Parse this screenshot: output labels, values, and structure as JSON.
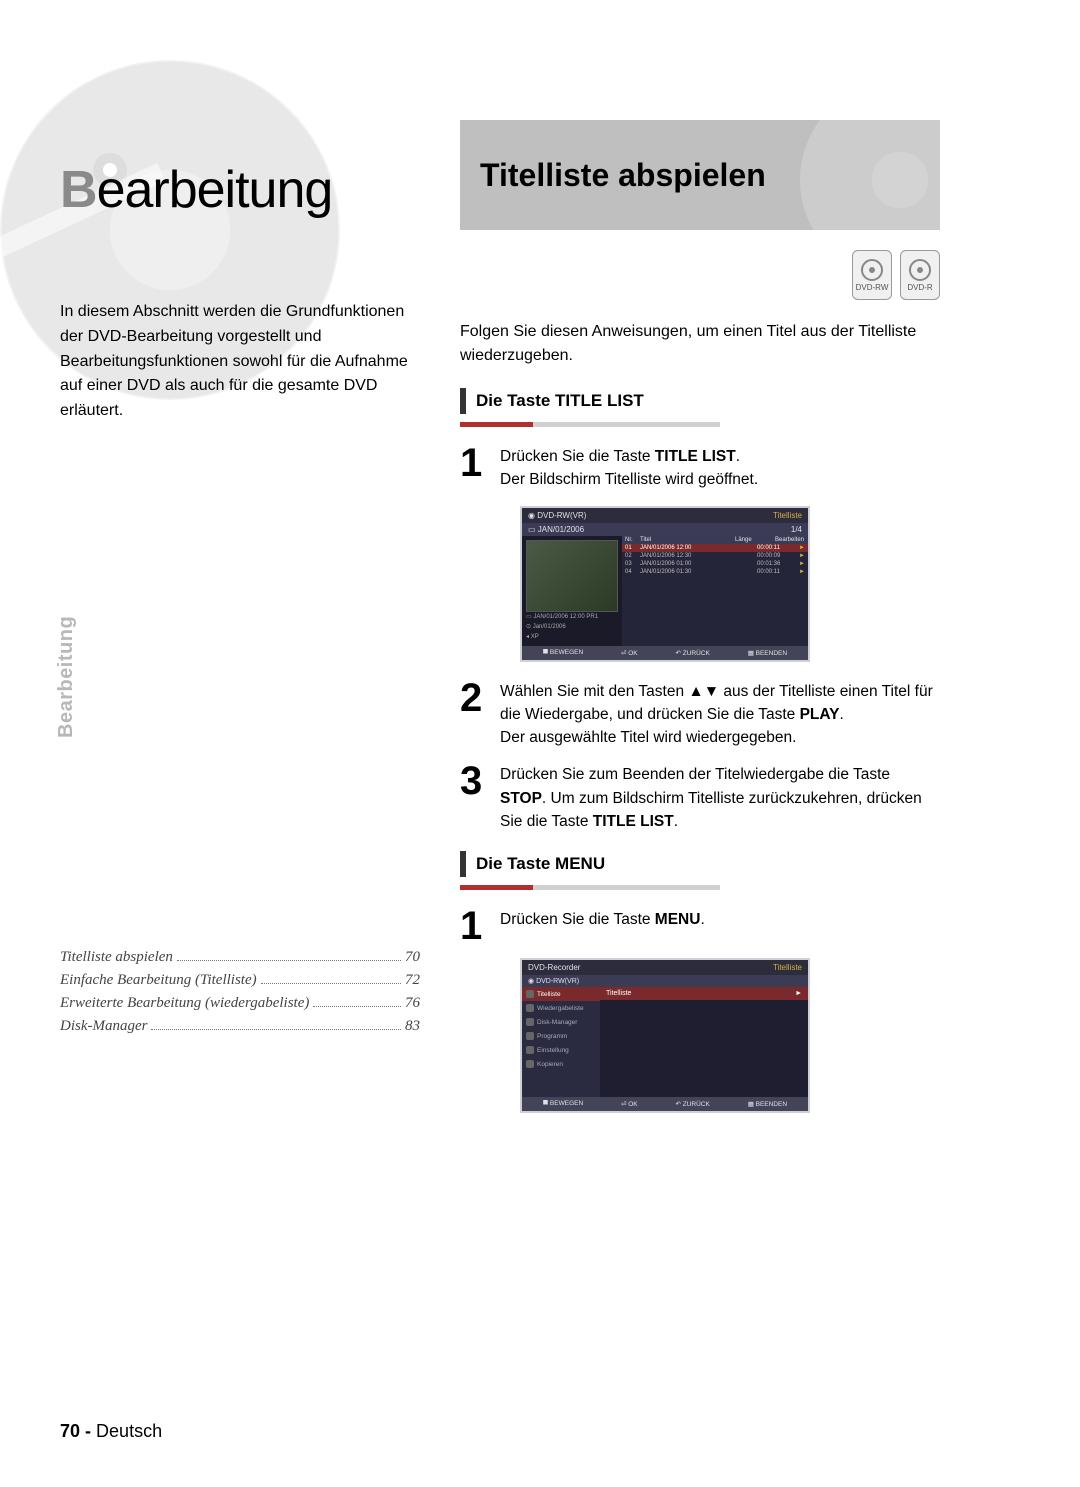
{
  "chapter": {
    "title_first": "B",
    "title_rest": "earbeitung",
    "intro": "In diesem Abschnitt werden die Grundfunktionen der DVD-Bearbeitung vorgestellt und Bearbeitungsfunktionen sowohl für die Aufnahme auf einer DVD als auch für die gesamte DVD erläutert."
  },
  "side_tab": "Bearbeitung",
  "toc": [
    {
      "title": "Titelliste abspielen",
      "page": "70"
    },
    {
      "title": "Einfache Bearbeitung (Titelliste)",
      "page": "72"
    },
    {
      "title": "Erweiterte Bearbeitung (wiedergabeliste)",
      "page": "76"
    },
    {
      "title": "Disk-Manager",
      "page": "83"
    }
  ],
  "footer": {
    "page": "70 -",
    "lang": "Deutsch"
  },
  "section": {
    "banner": "Titelliste abspielen",
    "badges": [
      "DVD-RW",
      "DVD-R"
    ],
    "lead": "Folgen Sie diesen Anweisungen, um einen Titel aus der Titelliste wiederzugeben.",
    "subA": "Die Taste TITLE LIST",
    "subB": "Die Taste MENU",
    "step1_a": "Drücken Sie die Taste ",
    "step1_b": "TITLE LIST",
    "step1_c": ".",
    "step1_d": "Der Bildschirm Titelliste wird geöffnet.",
    "step2_a": "Wählen Sie mit den Tasten ▲▼ aus der Titelliste einen Titel für die Wiedergabe, und drücken Sie die Taste ",
    "step2_b": "PLAY",
    "step2_c": ".",
    "step2_d": "Der ausgewählte Titel wird wiedergegeben.",
    "step3_a": "Drücken Sie zum Beenden der Titelwiedergabe die Taste ",
    "step3_b": "STOP",
    "step3_c": ". Um zum Bildschirm Titelliste zurück­zukehren, drücken Sie die Taste ",
    "step3_d": "TITLE LIST",
    "step3_e": ".",
    "stepB1_a": "Drücken Sie die Taste ",
    "stepB1_b": "MENU",
    "stepB1_c": "."
  },
  "osd1": {
    "header_l": "DVD-RW(VR)",
    "header_r": "Titelliste",
    "date": "JAN/01/2006",
    "counter": "1/4",
    "cols": [
      "Nr.",
      "Titel",
      "Länge",
      "Bearbeiten"
    ],
    "rows": [
      {
        "n": "01",
        "t": "JAN/01/2006 12:00",
        "d": "00:00:11",
        "sel": true
      },
      {
        "n": "02",
        "t": "JAN/01/2006 12:30",
        "d": "00:00:09",
        "sel": false
      },
      {
        "n": "03",
        "t": "JAN/01/2006 01:00",
        "d": "00:01:36",
        "sel": false
      },
      {
        "n": "04",
        "t": "JAN/01/2006 01:30",
        "d": "00:00:11",
        "sel": false
      }
    ],
    "meta1": "JAN/01/2006 12:00 PR1",
    "meta2": "Jan/01/2006",
    "meta3": "XP",
    "footer": [
      "⯀ BEWEGEN",
      "⏎ OK",
      "↶ ZURÜCK",
      "▦ BEENDEN"
    ]
  },
  "osd2": {
    "header_l": "DVD-Recorder",
    "header_r": "Titelliste",
    "sub": "DVD-RW(VR)",
    "side": [
      {
        "label": "Titelliste",
        "sel": true
      },
      {
        "label": "Wiedergabeliste",
        "sel": false
      },
      {
        "label": "Disk-Manager",
        "sel": false
      },
      {
        "label": "Programm",
        "sel": false
      },
      {
        "label": "Einstellung",
        "sel": false
      },
      {
        "label": "Kopieren",
        "sel": false
      }
    ],
    "main_row": "Titelliste",
    "main_arrow": "►",
    "footer": [
      "⯀ BEWEGEN",
      "⏎ OK",
      "↶ ZURÜCK",
      "▦ BEENDEN"
    ]
  }
}
